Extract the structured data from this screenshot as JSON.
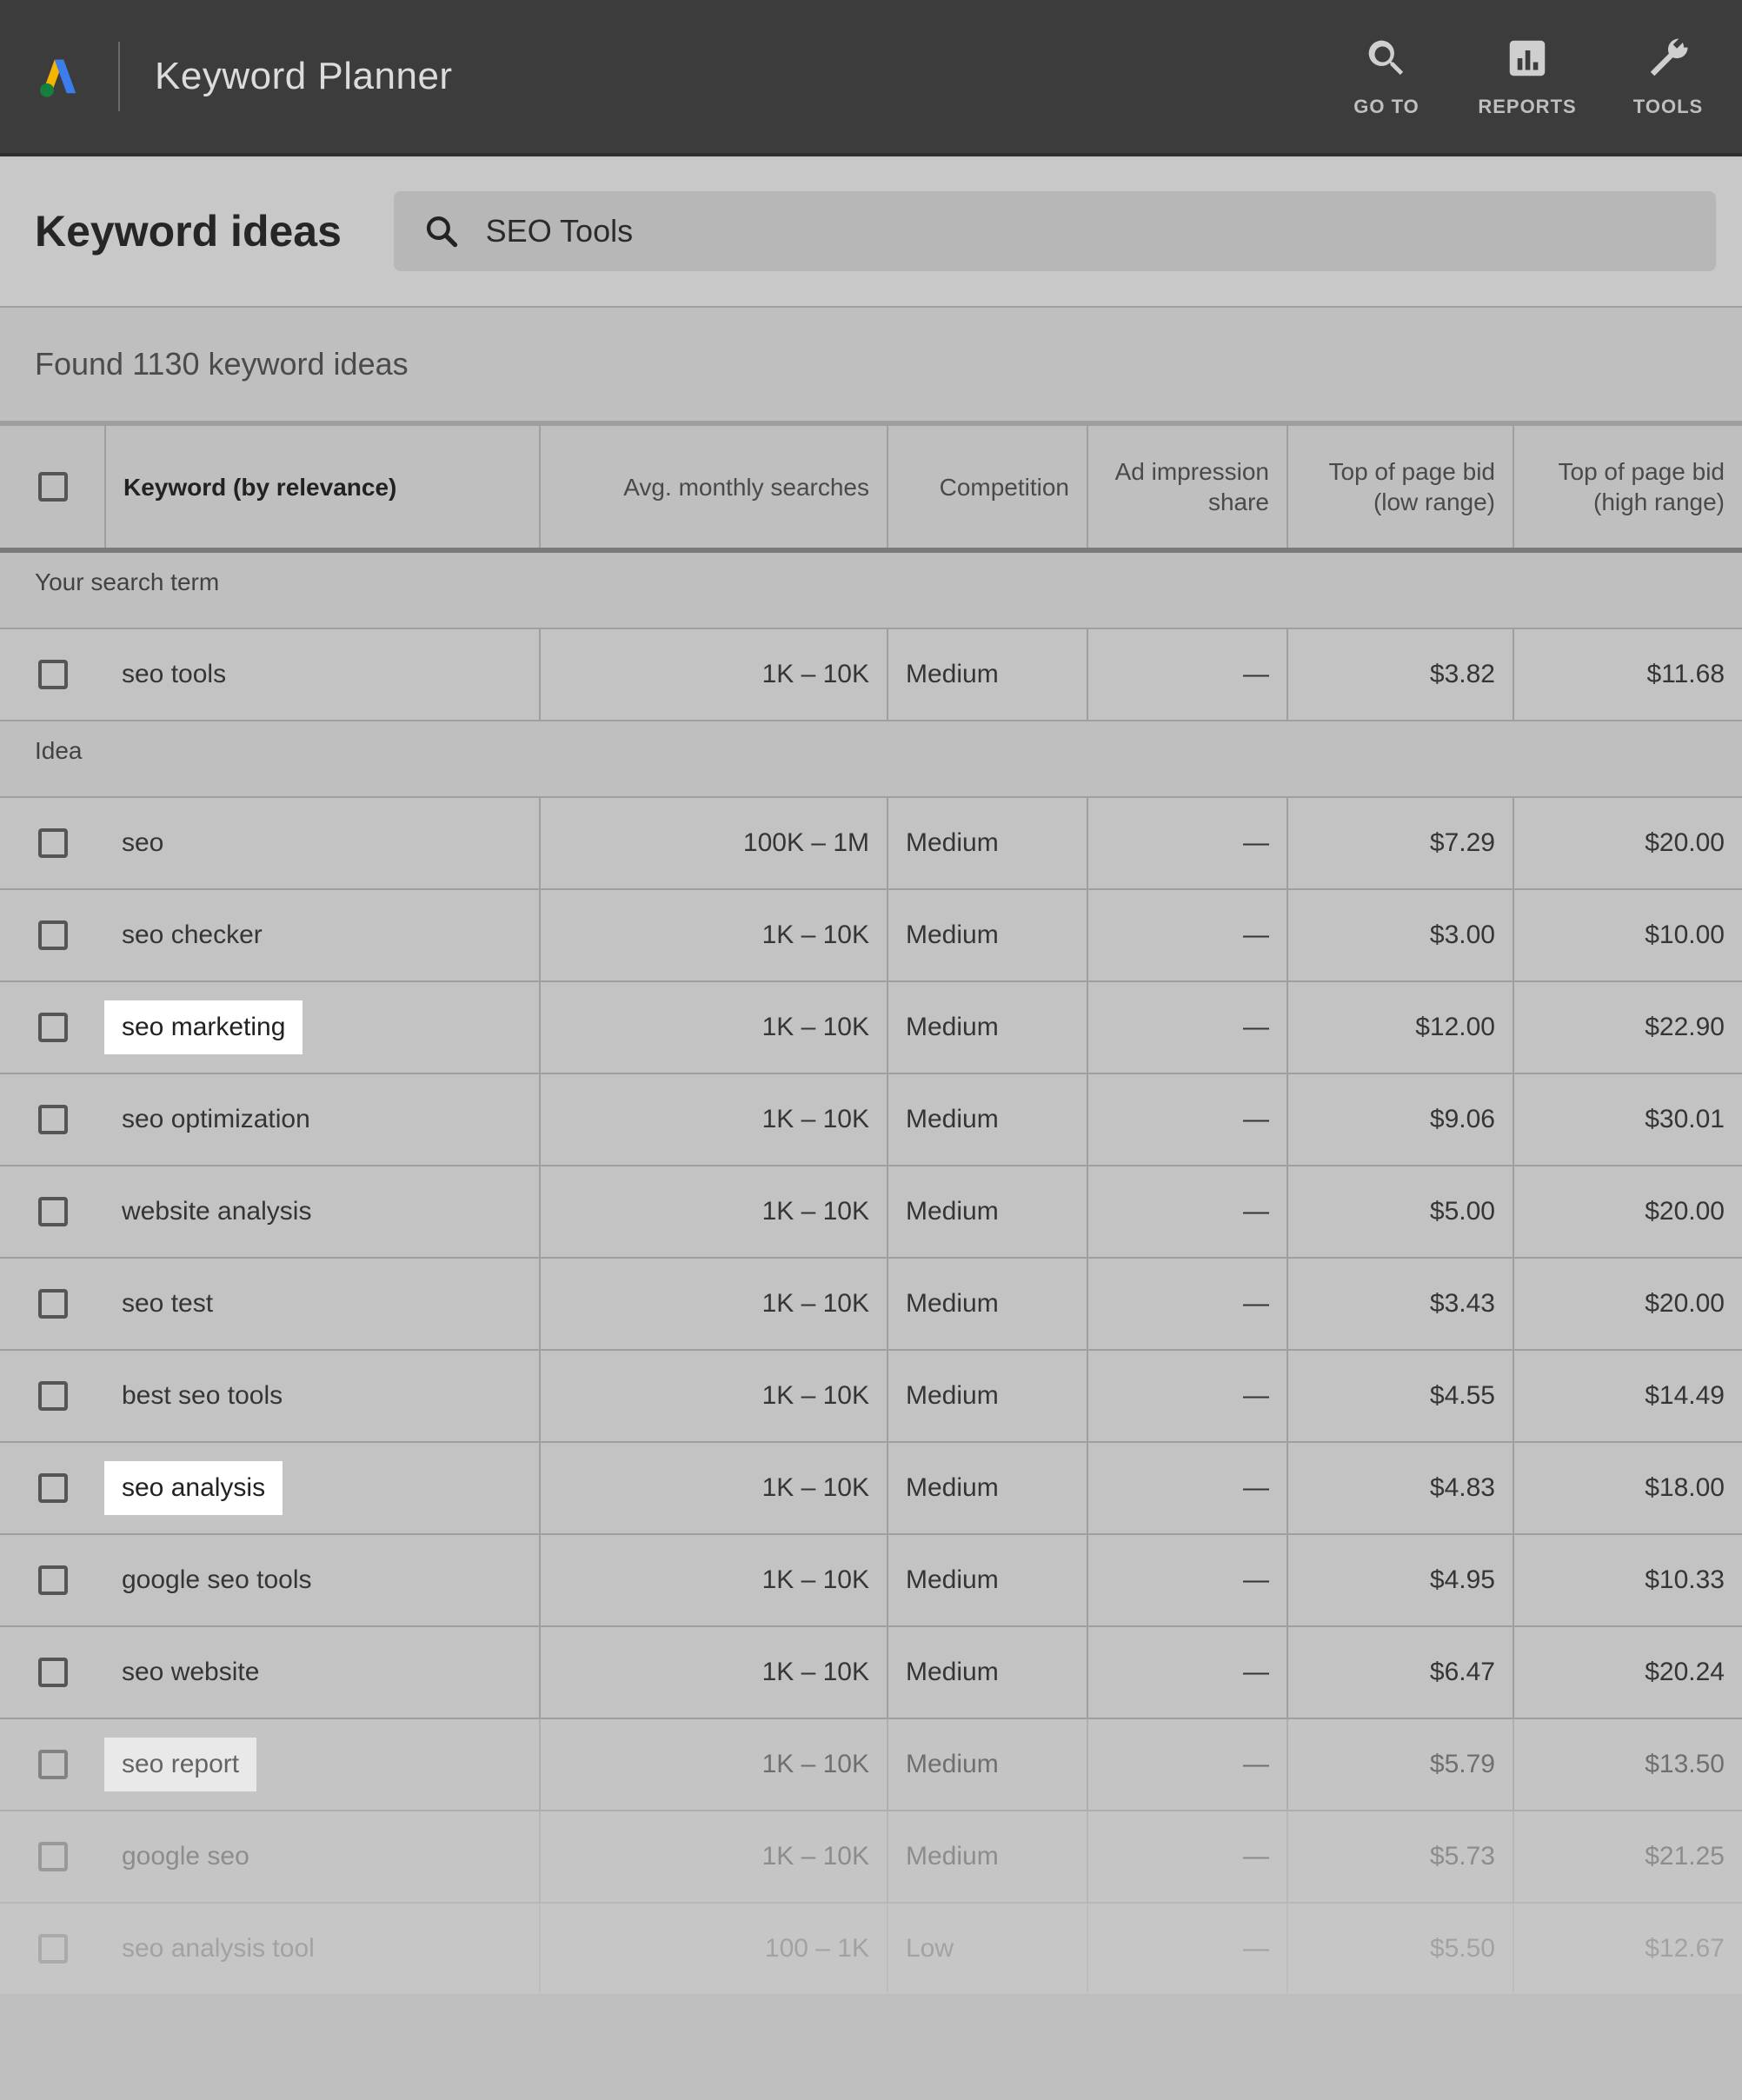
{
  "topbar": {
    "app_title": "Keyword Planner",
    "nav": {
      "goto": "GO TO",
      "reports": "REPORTS",
      "tools": "TOOLS"
    }
  },
  "page": {
    "title": "Keyword ideas",
    "search_value": "SEO Tools",
    "found_text": "Found 1130 keyword ideas"
  },
  "columns": {
    "keyword": "Keyword (by relevance)",
    "avg": "Avg. monthly searches",
    "competition": "Competition",
    "ad_share": "Ad impression share",
    "bid_low": "Top of page bid (low range)",
    "bid_high": "Top of page bid (high range)"
  },
  "sections": {
    "search_term": "Your search term",
    "idea": "Idea"
  },
  "rows": [
    {
      "group": "search_term",
      "keyword": "seo tools",
      "avg": "1K – 10K",
      "comp": "Medium",
      "share": "—",
      "low": "$3.82",
      "high": "$11.68",
      "hl": false,
      "fade": ""
    },
    {
      "group": "idea",
      "keyword": "seo",
      "avg": "100K – 1M",
      "comp": "Medium",
      "share": "—",
      "low": "$7.29",
      "high": "$20.00",
      "hl": false,
      "fade": ""
    },
    {
      "group": "idea",
      "keyword": "seo checker",
      "avg": "1K – 10K",
      "comp": "Medium",
      "share": "—",
      "low": "$3.00",
      "high": "$10.00",
      "hl": false,
      "fade": ""
    },
    {
      "group": "idea",
      "keyword": "seo marketing",
      "avg": "1K – 10K",
      "comp": "Medium",
      "share": "—",
      "low": "$12.00",
      "high": "$22.90",
      "hl": true,
      "fade": ""
    },
    {
      "group": "idea",
      "keyword": "seo optimization",
      "avg": "1K – 10K",
      "comp": "Medium",
      "share": "—",
      "low": "$9.06",
      "high": "$30.01",
      "hl": false,
      "fade": ""
    },
    {
      "group": "idea",
      "keyword": "website analysis",
      "avg": "1K – 10K",
      "comp": "Medium",
      "share": "—",
      "low": "$5.00",
      "high": "$20.00",
      "hl": false,
      "fade": ""
    },
    {
      "group": "idea",
      "keyword": "seo test",
      "avg": "1K – 10K",
      "comp": "Medium",
      "share": "—",
      "low": "$3.43",
      "high": "$20.00",
      "hl": false,
      "fade": ""
    },
    {
      "group": "idea",
      "keyword": "best seo tools",
      "avg": "1K – 10K",
      "comp": "Medium",
      "share": "—",
      "low": "$4.55",
      "high": "$14.49",
      "hl": false,
      "fade": ""
    },
    {
      "group": "idea",
      "keyword": "seo analysis",
      "avg": "1K – 10K",
      "comp": "Medium",
      "share": "—",
      "low": "$4.83",
      "high": "$18.00",
      "hl": true,
      "fade": ""
    },
    {
      "group": "idea",
      "keyword": "google seo tools",
      "avg": "1K – 10K",
      "comp": "Medium",
      "share": "—",
      "low": "$4.95",
      "high": "$10.33",
      "hl": false,
      "fade": ""
    },
    {
      "group": "idea",
      "keyword": "seo website",
      "avg": "1K – 10K",
      "comp": "Medium",
      "share": "—",
      "low": "$6.47",
      "high": "$20.24",
      "hl": false,
      "fade": ""
    },
    {
      "group": "idea",
      "keyword": "seo report",
      "avg": "1K – 10K",
      "comp": "Medium",
      "share": "—",
      "low": "$5.79",
      "high": "$13.50",
      "hl": true,
      "fade": "fade1"
    },
    {
      "group": "idea",
      "keyword": "google seo",
      "avg": "1K – 10K",
      "comp": "Medium",
      "share": "—",
      "low": "$5.73",
      "high": "$21.25",
      "hl": false,
      "fade": "fade2"
    },
    {
      "group": "idea",
      "keyword": "seo analysis tool",
      "avg": "100 – 1K",
      "comp": "Low",
      "share": "—",
      "low": "$5.50",
      "high": "$12.67",
      "hl": false,
      "fade": "fade3"
    }
  ]
}
